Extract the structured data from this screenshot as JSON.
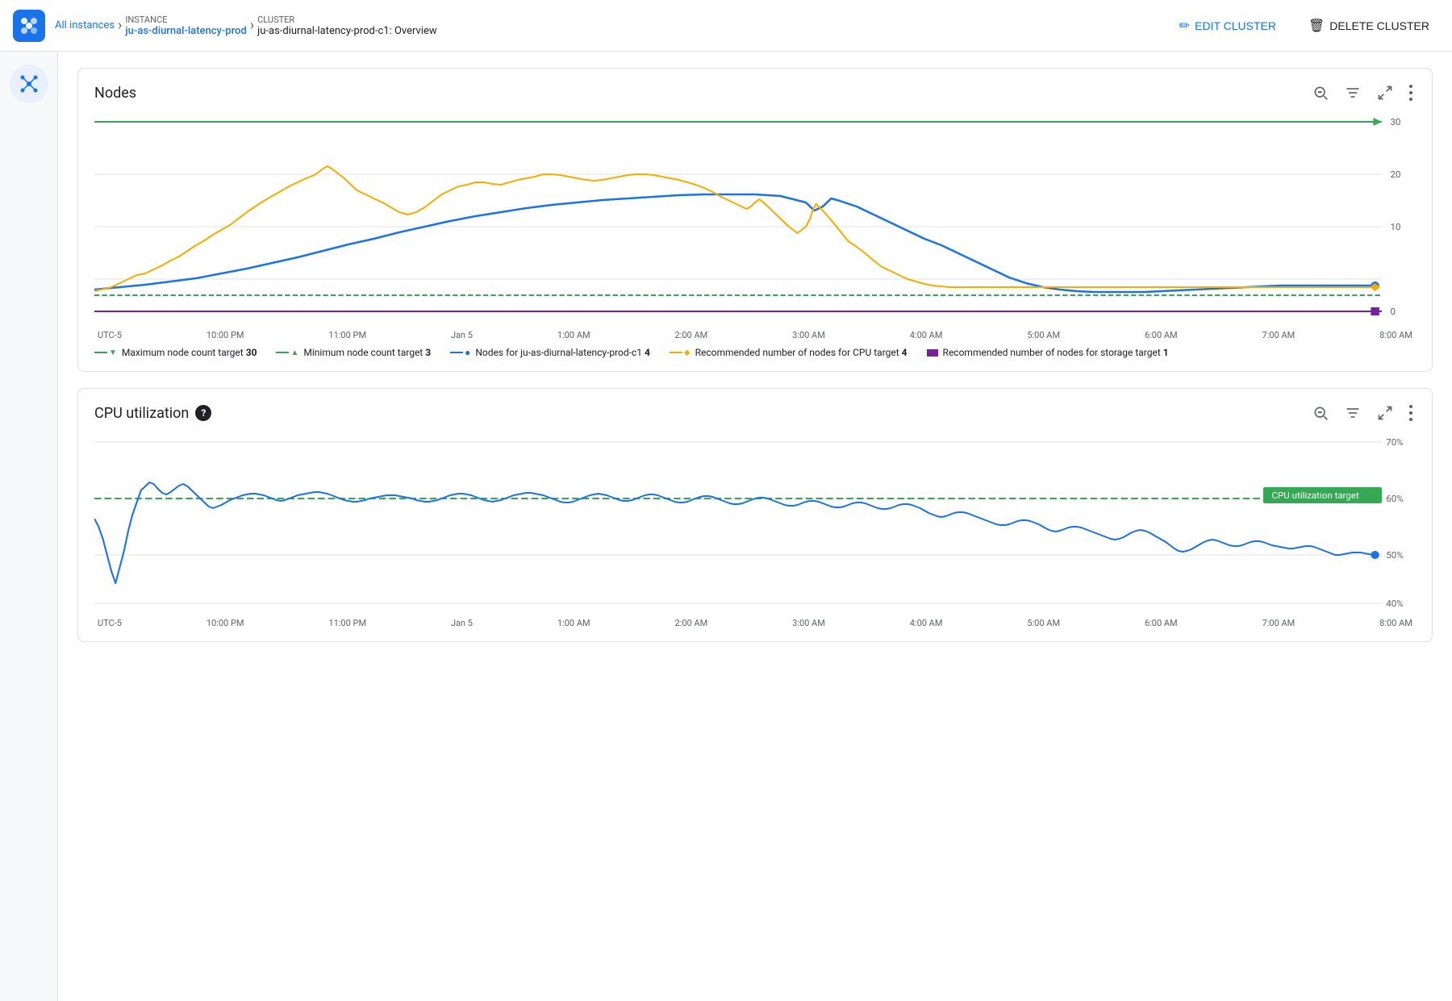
{
  "header": {
    "breadcrumb": {
      "all_instances": "All instances",
      "instance_label": "INSTANCE",
      "instance_value": "ju-as-diurnal-latency-prod",
      "cluster_label": "CLUSTER",
      "cluster_value": "ju-as-diurnal-latency-prod-c1: Overview"
    },
    "edit_button": "EDIT CLUSTER",
    "delete_button": "DELETE CLUSTER"
  },
  "nodes_chart": {
    "title": "Nodes",
    "legend": [
      {
        "id": "max-node",
        "label": "Maximum node count target",
        "value": "30",
        "color": "#34a853",
        "style": "dashed-down-arrow"
      },
      {
        "id": "min-node",
        "label": "Minimum node count target",
        "value": "3",
        "color": "#34a853",
        "style": "dashed-up-arrow"
      },
      {
        "id": "nodes-cluster",
        "label": "Nodes for ju-as-diurnal-latency-prod-c1",
        "value": "4",
        "color": "#1a73e8",
        "style": "line-dot"
      },
      {
        "id": "rec-cpu",
        "label": "Recommended number of nodes for CPU target",
        "value": "4",
        "color": "#f9ab00",
        "style": "line-diamond"
      },
      {
        "id": "rec-storage",
        "label": "Recommended number of nodes for storage target",
        "value": "1",
        "color": "#7b1fa2",
        "style": "line-square"
      }
    ],
    "y_axis": [
      "30",
      "20",
      "10",
      "0"
    ],
    "x_axis": [
      "UTC-5",
      "10:00 PM",
      "11:00 PM",
      "Jan 5",
      "1:00 AM",
      "2:00 AM",
      "3:00 AM",
      "4:00 AM",
      "5:00 AM",
      "6:00 AM",
      "7:00 AM",
      "8:00 AM"
    ]
  },
  "cpu_chart": {
    "title": "CPU utilization",
    "help": "?",
    "y_axis": [
      "70%",
      "60%",
      "50%",
      "40%"
    ],
    "x_axis": [
      "UTC-5",
      "10:00 PM",
      "11:00 PM",
      "Jan 5",
      "1:00 AM",
      "2:00 AM",
      "3:00 AM",
      "4:00 AM",
      "5:00 AM",
      "6:00 AM",
      "7:00 AM",
      "8:00 AM"
    ],
    "cpu_target_label": "CPU utilization target",
    "current_value": "50%"
  },
  "icons": {
    "search": "🔍",
    "filter": "≡",
    "fullscreen": "⛶",
    "more": "⋮",
    "edit_pencil": "✏",
    "delete_trash": "🗑"
  }
}
